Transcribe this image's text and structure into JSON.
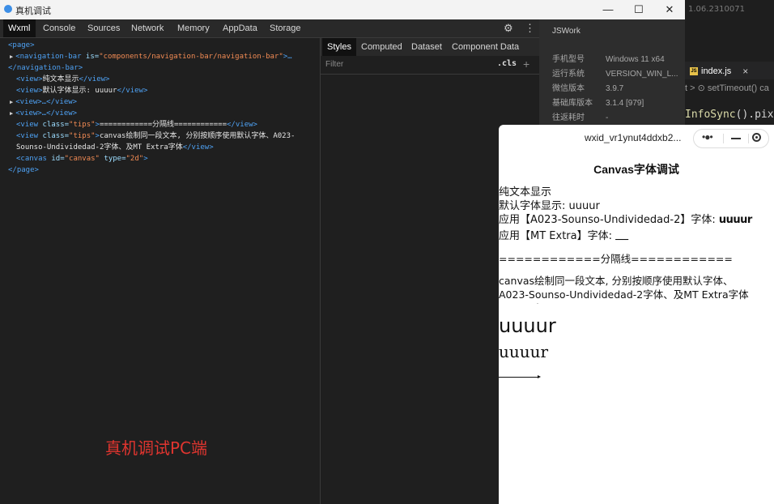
{
  "window": {
    "title": "真机调试"
  },
  "main_tabs": [
    "Wxml",
    "Console",
    "Sources",
    "Network",
    "Memory",
    "AppData",
    "Storage"
  ],
  "wxml_lines": {
    "l1": "<page>",
    "l2_tag": "<navigation-bar",
    "l2_attr": "is=",
    "l2_val": "\"components/navigation-bar/navigation-bar\"",
    "l2_end": ">…",
    "l3": "</navigation-bar>",
    "l4_open": "<view>",
    "l4_text": "纯文本显示",
    "l4_close": "</view>",
    "l5_open": "<view>",
    "l5_text": "默认字体显示: uuuur",
    "l5_close": "</view>",
    "l6": "<view>…</view>",
    "l7": "<view>…</view>",
    "l8_open": "<view",
    "l8_attr": "class=",
    "l8_val": "\"tips\"",
    "l8_gt": ">",
    "l8_text": "============分隔线============",
    "l8_close": "</view>",
    "l9_open": "<view",
    "l9_attr": "class=",
    "l9_val": "\"tips\"",
    "l9_gt": ">",
    "l9_text": "canvas绘制同一段文本, 分别按顺序使用默认字体、A023-",
    "l10_text": "Sounso-Undividedad-2字体、及MT Extra字体",
    "l10_close": "</view>",
    "l11_open": "<canvas",
    "l11_attr1": "id=",
    "l11_val1": "\"canvas\"",
    "l11_attr2": "type=",
    "l11_val2": "\"2d\"",
    "l11_gt": ">",
    "l12": "</page>"
  },
  "pc_label": "真机调试PC端",
  "styles_tabs": [
    "Styles",
    "Computed",
    "Dataset",
    "Component Data"
  ],
  "filter_placeholder": "Filter",
  "cls_label": ".cls",
  "plus_label": "+",
  "sysinfo": {
    "title": "JSWork",
    "rows": [
      {
        "k": "手机型号",
        "v": "Windows 11 x64"
      },
      {
        "k": "运行系统",
        "v": "VERSION_WIN_L..."
      },
      {
        "k": "微信版本",
        "v": "3.9.7"
      },
      {
        "k": "基础库版本",
        "v": "3.1.4 [979]"
      },
      {
        "k": "往返耗时",
        "v": "-"
      }
    ]
  },
  "editor": {
    "version": "1.06.2310071",
    "tab_file": "index.js",
    "tab_close": "×",
    "breadcrumb": "t > ⊙ setTimeout() ca",
    "code_fn": "InfoSync",
    "code_rest": "().pixe"
  },
  "simulator": {
    "account": "wxid_vr1ynut4ddxb2...",
    "nav_title": "Canvas字体调试",
    "line1": "纯文本显示",
    "line2": "默认字体显示: uuuur",
    "line3_prefix": "应用【A023-Sounso-Undividedad-2】字体: ",
    "line3_sample": "uuuur",
    "line4_prefix": "应用【MT Extra】字体: ",
    "line4_sample": "____",
    "dash_line": "============分隔线============",
    "tips1": "canvas绘制同一段文本, 分别按顺序使用默认字体、",
    "tips2": "A023-Sounso-Undividedad-2字体、及MT Extra字体",
    "canvas_tiny": "-",
    "canvas_text1": "uuuur",
    "canvas_text2": "uuuur"
  }
}
